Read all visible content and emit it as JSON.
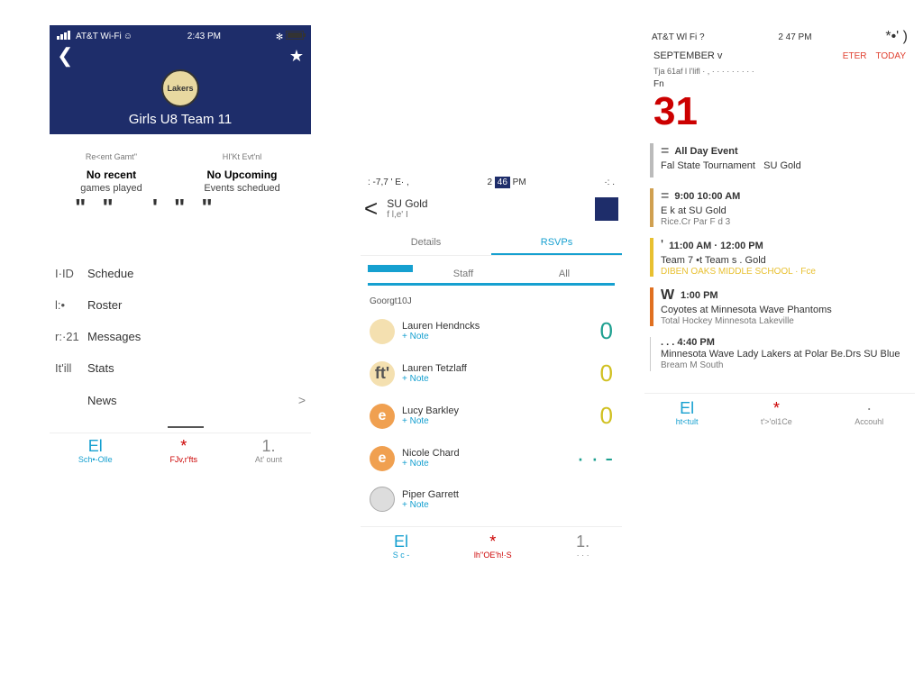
{
  "panel1": {
    "status": {
      "carrier": "AT&T Wi-Fi",
      "time": "2:43 PM"
    },
    "team": "Girls U8 Team 11",
    "summary": {
      "left_title": "Re<ent Gamt''",
      "left_main": "No recent",
      "left_sub": "games played",
      "right_title": "HI'Kt Evt'nl",
      "right_main": "No Upcoming",
      "right_sub": "Events schedued"
    },
    "menu": [
      "Schedue",
      "Roster",
      "Messages",
      "Stats",
      "News"
    ],
    "menu_icons": [
      "I·ID",
      "l:•",
      "r:·21",
      "It'ill",
      ""
    ],
    "tabbar": {
      "a": "Sch•-Olle",
      "a_ico": "El",
      "b": "FJv,r'fts",
      "b_ico": "*",
      "c": "At' ount",
      "c_ico": "1.",
      "arrow": ">"
    },
    "quote": "\"\"    '\"\""
  },
  "panel2": {
    "status": {
      "left": ": -7,7 ' E· ,",
      "time": "2 46 PM",
      "time_boxed": "46",
      "right": "·: ."
    },
    "back": "<",
    "title": "SU Gold",
    "subtitle": "f l,e' I",
    "tabs": [
      "Details",
      "RSVPs"
    ],
    "segments": [
      "",
      "Staff",
      "All"
    ],
    "category": "Goorgt10J",
    "roster": [
      {
        "avatar": "",
        "name": "Lauren Hendncks",
        "note": "+ Note",
        "status": "0",
        "status_class": "st-teal"
      },
      {
        "avatar": "ft'",
        "name": "Lauren Tetzlaff",
        "note": "+ Note",
        "status": "0",
        "status_class": "st-yellow"
      },
      {
        "avatar": "e",
        "name": "Lucy Barkley",
        "note": "+ Note",
        "status": "0",
        "status_class": "st-yellow"
      },
      {
        "avatar": "e",
        "name": "Nicole Chard",
        "note": "+ Note",
        "status": "· · -",
        "status_class": "st-teal"
      },
      {
        "avatar": "",
        "name": "Piper Garrett",
        "note": "+ Note",
        "status": "",
        "status_class": "st-gray"
      }
    ],
    "tabbar": {
      "a": "S  c -",
      "a_ico": "El",
      "b": "lh''OE'h!·S",
      "b_ico": "*",
      "c": "· · ·",
      "c_ico": "1."
    }
  },
  "panel3": {
    "status": {
      "carrier": "AT&T Wl Fi ?",
      "time": "2 47 PM",
      "right": "*•' )"
    },
    "month": "SEPTEMBER v",
    "actions": [
      "ETER",
      "TODAY"
    ],
    "weekday_line": "Tja  61af l l'lifl  · ,  · · · · · · · · ·",
    "dayname": "Fn",
    "daynum": "31",
    "events": [
      {
        "bar": "eb-gray",
        "eq": "=",
        "time": "All Day Event",
        "title": "Fal State Tournament",
        "right": "SU Gold"
      },
      {
        "bar": "eb-tan",
        "eq": "=",
        "time": "9:00   10:00 AM",
        "title": "E k          at SU Gold",
        "loc": "Rice.Cr      Par    F   d 3"
      },
      {
        "bar": "eb-yellow",
        "eq": "'",
        "time": "11:00 AM · 12:00 PM",
        "title": "Team  7 •t  Team s .  Gold",
        "loc": "DIBEN OAKS MIDDLE SCHOOL  · Fce"
      },
      {
        "bar": "eb-orange",
        "eq": "W",
        "time": "1:00 PM",
        "title": "Coyotes at  Minnesota Wave Phantoms",
        "loc": "Total Hockey Minnesota   Lakeville"
      },
      {
        "bar": "eb-white",
        "eq": "",
        "time": ". . . 4:40 PM",
        "title": "Minnesota Wave Lady Lakers at Polar Be.Drs SU Blue",
        "loc": "Bream M South"
      }
    ],
    "tabbar": {
      "a": "ht<tult",
      "a_ico": "El",
      "b": "t'>'ol1Ce",
      "b_ico": "*",
      "c": "Accouhl",
      "c_ico": "·"
    }
  }
}
